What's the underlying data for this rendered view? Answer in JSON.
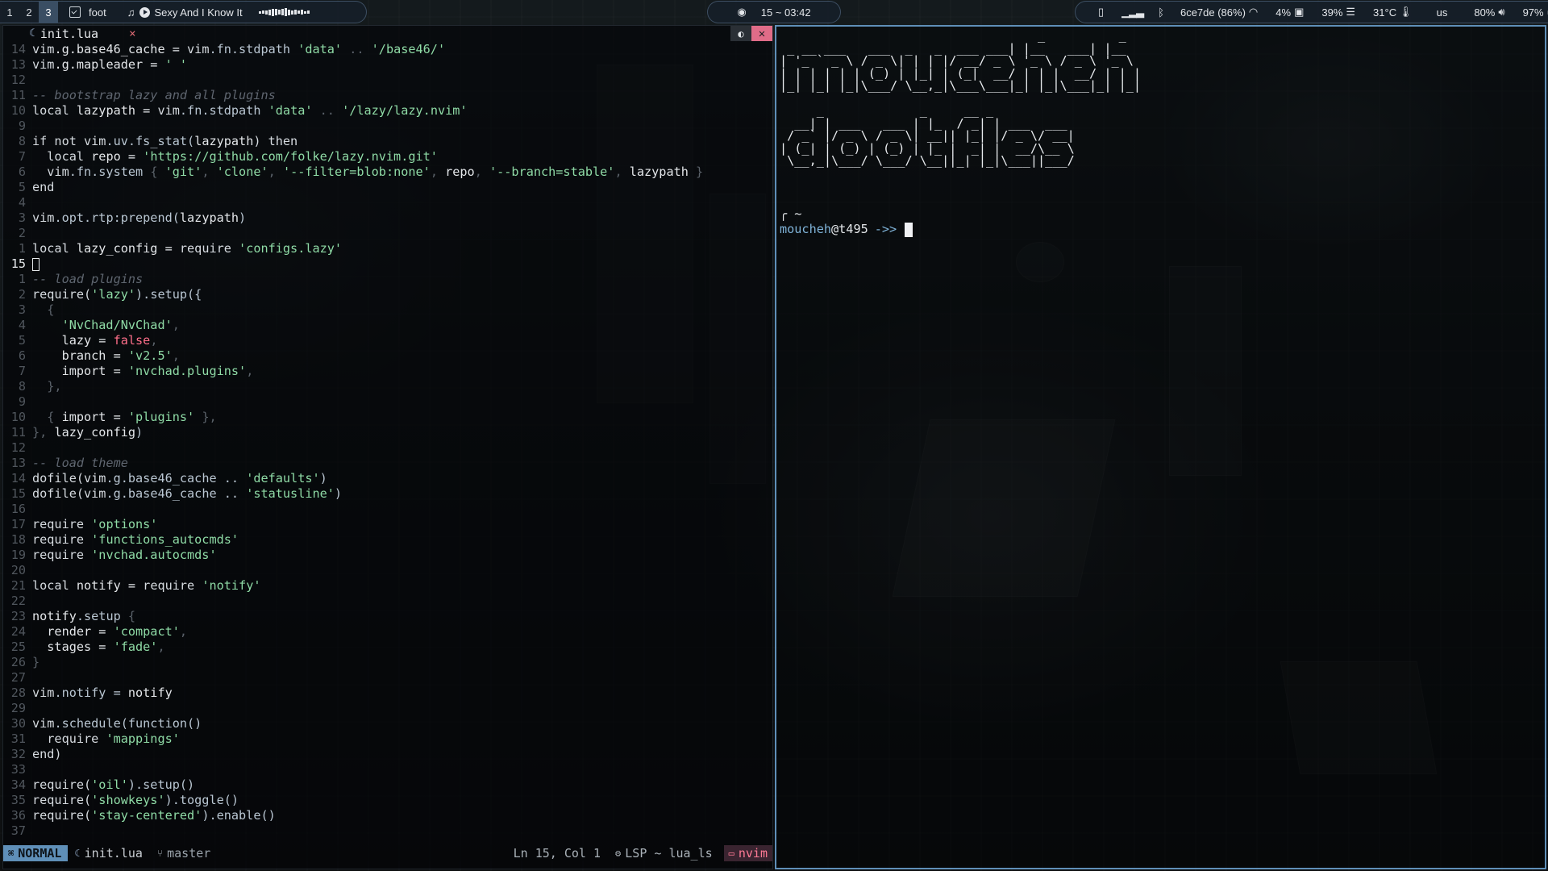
{
  "topbar": {
    "workspaces": [
      "1",
      "2",
      "3"
    ],
    "active_workspace": "3",
    "app_icon": "terminal-icon",
    "app_name": "foot",
    "music_icon": "music-note-icon",
    "song": "Sexy And I Know It",
    "eye_icon": "eye-icon",
    "clock": "15 ~ 03:42",
    "status": {
      "bt_device_icon": "bluetooth-device-icon",
      "signal_icon": "signal-bars-icon",
      "bluetooth_icon": "bluetooth-icon",
      "network": "6ce7de (86%)",
      "wifi_icon": "wifi-icon",
      "cpu": "4%",
      "cpu_icon": "cpu-icon",
      "mem": "39%",
      "mem_icon": "memory-icon",
      "temp": "31°C",
      "temp_icon": "thermometer-icon",
      "layout": "us",
      "volume": "80%",
      "volume_icon": "speaker-icon",
      "battery": "97%",
      "battery_icon": "battery-icon"
    }
  },
  "editor": {
    "tab_label": "init.lua",
    "tab_close": "×",
    "statusline": {
      "mode": "NORMAL",
      "file": "init.lua",
      "branch": "master",
      "position": "Ln 15, Col 1",
      "lsp": "LSP ~ lua_ls",
      "project": "nvim"
    },
    "lines": [
      {
        "n": "14",
        "t": [
          [
            "vim",
            "c-key"
          ],
          [
            ".g.base46_cache = ",
            "txt"
          ],
          [
            "vim",
            "c-key"
          ],
          [
            ".fn.stdpath ",
            "c-fn"
          ],
          [
            "'data'",
            "c-str"
          ],
          [
            " .. ",
            "c-pun"
          ],
          [
            "'/base46/'",
            "c-str"
          ]
        ]
      },
      {
        "n": "13",
        "t": [
          [
            "vim",
            "c-key"
          ],
          [
            ".g.mapleader = ",
            "txt"
          ],
          [
            "' '",
            "c-str"
          ]
        ]
      },
      {
        "n": "12",
        "t": []
      },
      {
        "n": "11",
        "t": [
          [
            "-- bootstrap lazy and all plugins",
            "c-com"
          ]
        ]
      },
      {
        "n": "10",
        "t": [
          [
            "local ",
            "c-key"
          ],
          [
            "lazypath = ",
            "txt"
          ],
          [
            "vim",
            "c-key"
          ],
          [
            ".fn.stdpath ",
            "c-fn"
          ],
          [
            "'data'",
            "c-str"
          ],
          [
            " .. ",
            "c-pun"
          ],
          [
            "'/lazy/lazy.nvim'",
            "c-str"
          ]
        ]
      },
      {
        "n": "9",
        "t": []
      },
      {
        "n": "8",
        "t": [
          [
            "if not ",
            "c-key"
          ],
          [
            "vim",
            "c-key"
          ],
          [
            ".uv.fs_stat(",
            "c-fn"
          ],
          [
            "lazypath",
            "txt"
          ],
          [
            ") then",
            "c-key"
          ]
        ]
      },
      {
        "n": "7",
        "t": [
          [
            "  local ",
            "c-key"
          ],
          [
            "repo = ",
            "txt"
          ],
          [
            "'https://github.com/folke/lazy.nvim.git'",
            "c-str"
          ]
        ]
      },
      {
        "n": "6",
        "t": [
          [
            "  vim",
            "c-key"
          ],
          [
            ".fn.system ",
            "c-fn"
          ],
          [
            "{ ",
            "c-pun"
          ],
          [
            "'git'",
            "c-str"
          ],
          [
            ", ",
            "c-pun"
          ],
          [
            "'clone'",
            "c-str"
          ],
          [
            ", ",
            "c-pun"
          ],
          [
            "'--filter=blob:none'",
            "c-str"
          ],
          [
            ", ",
            "c-pun"
          ],
          [
            "repo",
            "txt"
          ],
          [
            ", ",
            "c-pun"
          ],
          [
            "'--branch=stable'",
            "c-str"
          ],
          [
            ", ",
            "c-pun"
          ],
          [
            "lazypath",
            "txt"
          ],
          [
            " }",
            "c-pun"
          ]
        ]
      },
      {
        "n": "5",
        "t": [
          [
            "end",
            "c-key"
          ]
        ]
      },
      {
        "n": "4",
        "t": []
      },
      {
        "n": "3",
        "t": [
          [
            "vim",
            "c-key"
          ],
          [
            ".opt.rtp:prepend(",
            "c-fn"
          ],
          [
            "lazypath",
            "txt"
          ],
          [
            ")",
            "c-fn"
          ]
        ]
      },
      {
        "n": "2",
        "t": []
      },
      {
        "n": "1",
        "t": [
          [
            "local ",
            "c-key"
          ],
          [
            "lazy_config = ",
            "txt"
          ],
          [
            "require ",
            "c-key"
          ],
          [
            "'configs.lazy'",
            "c-str"
          ]
        ]
      },
      {
        "n": "15",
        "t": [
          [
            "__CURSOR__",
            "cursor"
          ]
        ],
        "current": true
      },
      {
        "n": "1",
        "t": [
          [
            "-- load plugins",
            "c-com"
          ]
        ]
      },
      {
        "n": "2",
        "t": [
          [
            "require(",
            "c-key"
          ],
          [
            "'lazy'",
            "c-str"
          ],
          [
            ").setup({",
            "c-fn"
          ]
        ]
      },
      {
        "n": "3",
        "t": [
          [
            "  {",
            "c-pun"
          ]
        ]
      },
      {
        "n": "4",
        "t": [
          [
            "    'NvChad/NvChad'",
            "c-str"
          ],
          [
            ",",
            "c-pun"
          ]
        ]
      },
      {
        "n": "5",
        "t": [
          [
            "    lazy = ",
            "txt"
          ],
          [
            "false",
            "c-bool"
          ],
          [
            ",",
            "c-pun"
          ]
        ]
      },
      {
        "n": "6",
        "t": [
          [
            "    branch = ",
            "txt"
          ],
          [
            "'v2.5'",
            "c-str"
          ],
          [
            ",",
            "c-pun"
          ]
        ]
      },
      {
        "n": "7",
        "t": [
          [
            "    import = ",
            "txt"
          ],
          [
            "'nvchad.plugins'",
            "c-str"
          ],
          [
            ",",
            "c-pun"
          ]
        ]
      },
      {
        "n": "8",
        "t": [
          [
            "  },",
            "c-pun"
          ]
        ]
      },
      {
        "n": "9",
        "t": []
      },
      {
        "n": "10",
        "t": [
          [
            "  { ",
            "c-pun"
          ],
          [
            "import = ",
            "txt"
          ],
          [
            "'plugins'",
            "c-str"
          ],
          [
            " },",
            "c-pun"
          ]
        ]
      },
      {
        "n": "11",
        "t": [
          [
            "}, ",
            "c-pun"
          ],
          [
            "lazy_config",
            "txt"
          ],
          [
            ")",
            "c-fn"
          ]
        ]
      },
      {
        "n": "12",
        "t": []
      },
      {
        "n": "13",
        "t": [
          [
            "-- load theme",
            "c-com"
          ]
        ]
      },
      {
        "n": "14",
        "t": [
          [
            "dofile(",
            "c-key"
          ],
          [
            "vim",
            "c-key"
          ],
          [
            ".g.base46_cache .. ",
            "c-fn"
          ],
          [
            "'defaults'",
            "c-str"
          ],
          [
            ")",
            "c-fn"
          ]
        ]
      },
      {
        "n": "15",
        "t": [
          [
            "dofile(",
            "c-key"
          ],
          [
            "vim",
            "c-key"
          ],
          [
            ".g.base46_cache .. ",
            "c-fn"
          ],
          [
            "'statusline'",
            "c-str"
          ],
          [
            ")",
            "c-fn"
          ]
        ]
      },
      {
        "n": "16",
        "t": []
      },
      {
        "n": "17",
        "t": [
          [
            "require ",
            "c-key"
          ],
          [
            "'options'",
            "c-str"
          ]
        ]
      },
      {
        "n": "18",
        "t": [
          [
            "require ",
            "c-key"
          ],
          [
            "'functions_autocmds'",
            "c-str"
          ]
        ]
      },
      {
        "n": "19",
        "t": [
          [
            "require ",
            "c-key"
          ],
          [
            "'nvchad.autocmds'",
            "c-str"
          ]
        ]
      },
      {
        "n": "20",
        "t": []
      },
      {
        "n": "21",
        "t": [
          [
            "local ",
            "c-key"
          ],
          [
            "notify = ",
            "txt"
          ],
          [
            "require ",
            "c-key"
          ],
          [
            "'notify'",
            "c-str"
          ]
        ]
      },
      {
        "n": "22",
        "t": []
      },
      {
        "n": "23",
        "t": [
          [
            "notify",
            "txt"
          ],
          [
            ".setup ",
            "c-fn"
          ],
          [
            "{",
            "c-pun"
          ]
        ]
      },
      {
        "n": "24",
        "t": [
          [
            "  render = ",
            "txt"
          ],
          [
            "'compact'",
            "c-str"
          ],
          [
            ",",
            "c-pun"
          ]
        ]
      },
      {
        "n": "25",
        "t": [
          [
            "  stages = ",
            "txt"
          ],
          [
            "'fade'",
            "c-str"
          ],
          [
            ",",
            "c-pun"
          ]
        ]
      },
      {
        "n": "26",
        "t": [
          [
            "}",
            "c-pun"
          ]
        ]
      },
      {
        "n": "27",
        "t": []
      },
      {
        "n": "28",
        "t": [
          [
            "vim",
            "c-key"
          ],
          [
            ".notify = ",
            "c-fn"
          ],
          [
            "notify",
            "txt"
          ]
        ]
      },
      {
        "n": "29",
        "t": []
      },
      {
        "n": "30",
        "t": [
          [
            "vim",
            "c-key"
          ],
          [
            ".schedule(function()",
            "c-fn"
          ]
        ]
      },
      {
        "n": "31",
        "t": [
          [
            "  require ",
            "c-key"
          ],
          [
            "'mappings'",
            "c-str"
          ]
        ]
      },
      {
        "n": "32",
        "t": [
          [
            "end)",
            "c-key"
          ]
        ]
      },
      {
        "n": "33",
        "t": []
      },
      {
        "n": "34",
        "t": [
          [
            "require(",
            "c-key"
          ],
          [
            "'oil'",
            "c-str"
          ],
          [
            ").setup()",
            "c-fn"
          ]
        ]
      },
      {
        "n": "35",
        "t": [
          [
            "require(",
            "c-key"
          ],
          [
            "'showkeys'",
            "c-str"
          ],
          [
            ").toggle()",
            "c-fn"
          ]
        ]
      },
      {
        "n": "36",
        "t": [
          [
            "require(",
            "c-key"
          ],
          [
            "'stay-centered'",
            "c-str"
          ],
          [
            ").enable()",
            "c-fn"
          ]
        ]
      },
      {
        "n": "37",
        "t": []
      }
    ]
  },
  "terminal": {
    "ascii_art": "                                   _          _\n _ __ ___   ___  _   _  ___ ___| |__   ___| |__\n| '_ ` _ \\ / _ \\| | | |/ __/ _ \\ '_ \\ / _ \\ '_ \\\n| | | | | | (_) | |_| | (_|  __/ | | |  __/ | | |\n|_| |_| |_|\\___/ \\__,_|\\___\\___|_| |_|\\___|_| |_|\n\n     _             _     __ _\n  __| | ___   ___ | |_  / _| | ___  ___\n / _` |/ _ \\ / _ \\| __|| |_| |/ _ \\/ __|\n| (_| | (_) | (_) | |_ |  _| |  __/\\__ \\\n \\__,_|\\___/ \\___/ \\__||_| |_|\\___||___/",
    "prompt_top": "╭ ~",
    "user": "moucheh",
    "host": "@t495",
    "arrow": "->>"
  }
}
